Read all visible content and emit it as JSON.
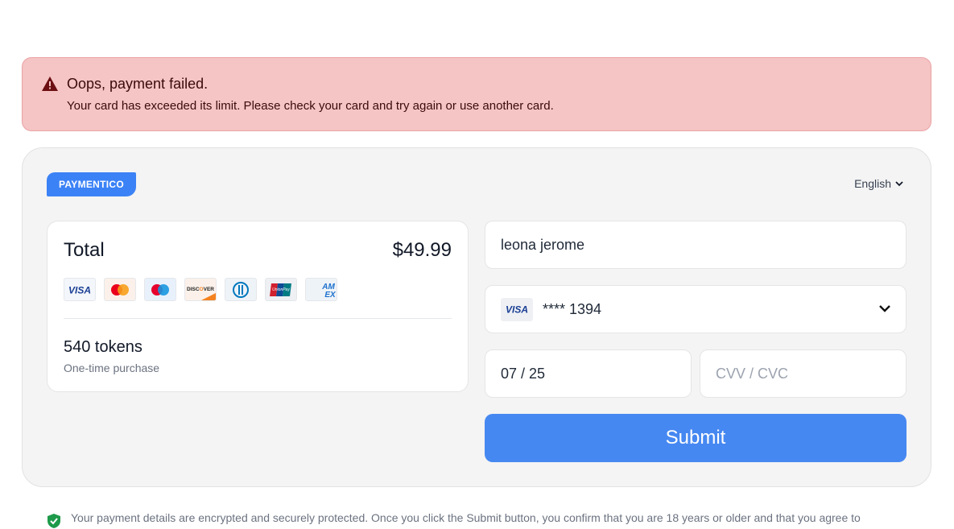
{
  "alert": {
    "title": "Oops, payment failed.",
    "message": "Your card has exceeded its limit. Please check your card and try again or use another card.",
    "icon": "warning-triangle-icon",
    "color": "#f5c4c4"
  },
  "brand": {
    "logo_text": "PAYMENTICO",
    "color": "#3b82f6"
  },
  "language": {
    "selected": "English",
    "icon": "chevron-down-icon"
  },
  "summary": {
    "total_label": "Total",
    "total_amount": "$49.99",
    "card_brands": [
      "visa",
      "mastercard",
      "maestro",
      "discover",
      "diners-club",
      "unionpay",
      "amex"
    ],
    "product": "540 tokens",
    "purchase_type": "One-time purchase"
  },
  "form": {
    "cardholder_name": "leona jerome",
    "saved_card_brand": "VISA",
    "saved_card_number": "**** 1394",
    "expiry_value": "07 / 25",
    "cvv_placeholder": "CVV / CVC",
    "submit_label": "Submit",
    "submit_color": "#4688f1"
  },
  "security": {
    "icon": "shield-check-icon",
    "text": "Your payment details are encrypted and securely protected. Once you click the Submit button, you confirm that you are 18 years or older and that you agree to"
  }
}
